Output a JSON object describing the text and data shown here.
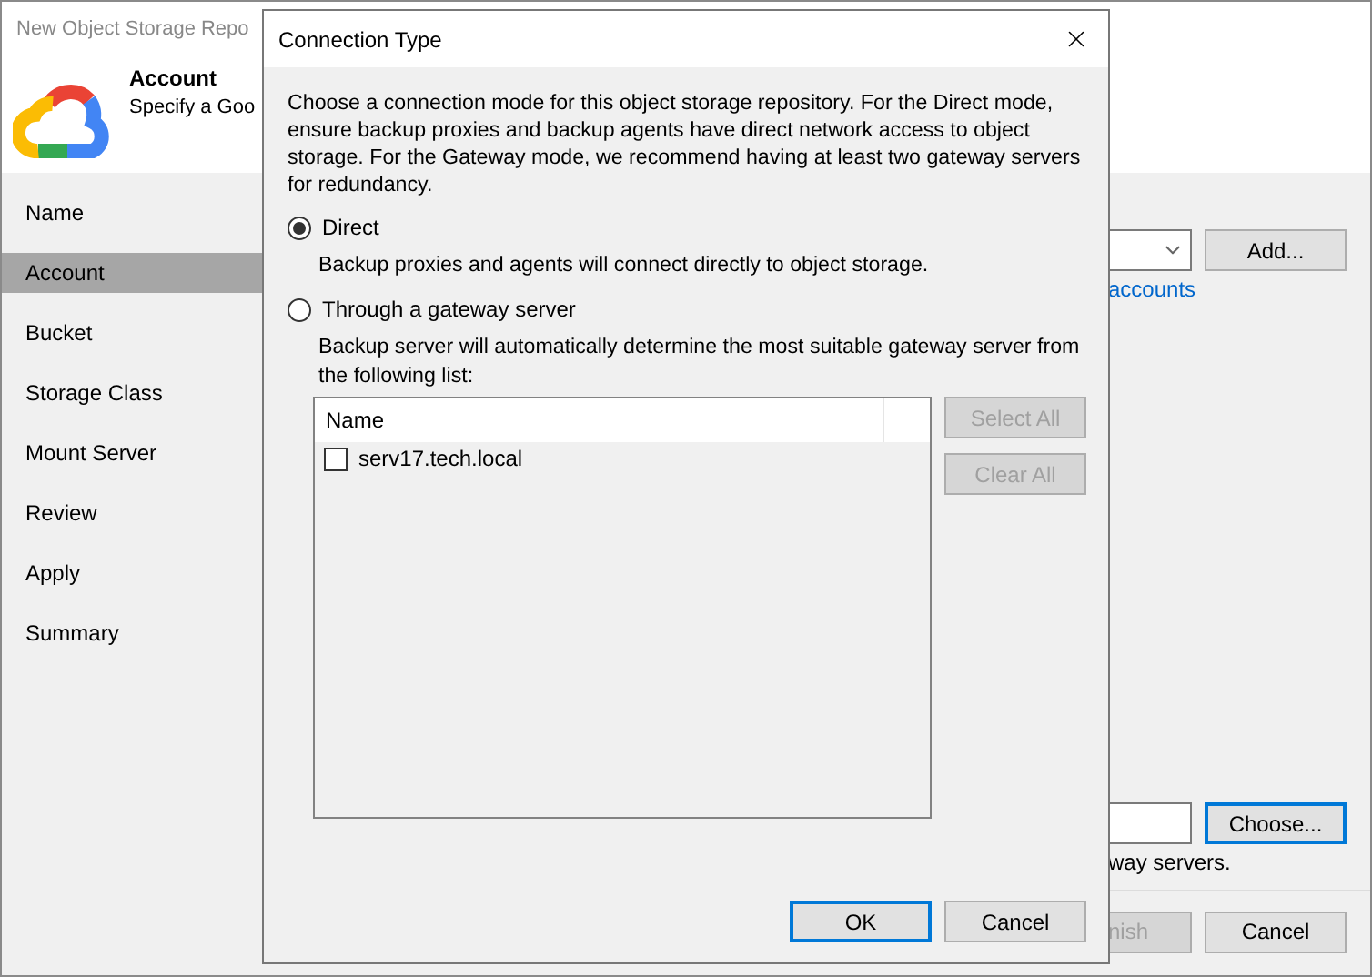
{
  "main_window": {
    "title": "New Object Storage Repo",
    "header": {
      "title": "Account",
      "subtitle": "Specify a Goo"
    },
    "steps": [
      {
        "label": "Name",
        "selected": false
      },
      {
        "label": "Account",
        "selected": true
      },
      {
        "label": "Bucket",
        "selected": false
      },
      {
        "label": "Storage Class",
        "selected": false
      },
      {
        "label": "Mount Server",
        "selected": false
      },
      {
        "label": "Review",
        "selected": false
      },
      {
        "label": "Apply",
        "selected": false
      },
      {
        "label": "Summary",
        "selected": false
      }
    ],
    "add_button": "Add...",
    "accounts_link": "accounts",
    "choose_button": "Choose...",
    "gateway_note": "way servers.",
    "buttons": [
      {
        "label": "nish",
        "disabled": true
      },
      {
        "label": "Cancel",
        "disabled": false
      }
    ]
  },
  "dialog": {
    "title": "Connection Type",
    "description": "Choose a connection mode for this object storage repository. For the Direct mode, ensure backup proxies and backup agents have direct network access to object storage. For the Gateway mode, we recommend having at least two gateway servers for redundancy.",
    "modes": [
      {
        "label": "Direct",
        "selected": true,
        "hint": "Backup proxies and agents will connect directly to object storage."
      },
      {
        "label": "Through a gateway server",
        "selected": false,
        "hint": "Backup server will automatically determine the most suitable gateway server from the following list:"
      }
    ],
    "server_list": {
      "columns": [
        "Name"
      ],
      "rows": [
        {
          "name": "serv17.tech.local",
          "checked": false
        }
      ]
    },
    "list_buttons": [
      {
        "label": "Select All",
        "disabled": true
      },
      {
        "label": "Clear All",
        "disabled": true
      }
    ],
    "buttons": [
      {
        "label": "OK",
        "default": true
      },
      {
        "label": "Cancel",
        "default": false
      }
    ]
  }
}
